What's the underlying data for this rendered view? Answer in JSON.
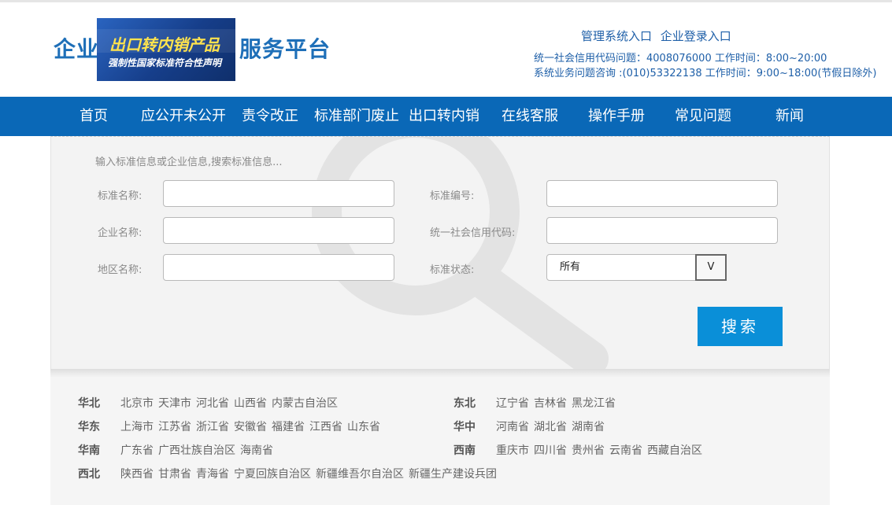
{
  "header": {
    "title_left": "企业",
    "title_right": "服务平台",
    "promo": {
      "line1": "出口转内销产品",
      "line2": "强制性国家标准符合性声明"
    },
    "links": [
      "管理系统入口",
      "企业登录入口"
    ],
    "contact_line1": "统一社会信用代码问题：4008076000 工作时间：8:00~20:00",
    "contact_line2": "系统业务问题咨询 :(010)53322138 工作时间：9:00~18:00(节假日除外)"
  },
  "nav": {
    "items": [
      "首页",
      "应公开未公开",
      "责令改正",
      "标准部门废止",
      "出口转内销",
      "在线客服",
      "操作手册",
      "常见问题",
      "新闻"
    ]
  },
  "search": {
    "hint": "输入标准信息或企业信息,搜索标准信息...",
    "standard_name_label": "标准名称:",
    "standard_no_label": "标准编号:",
    "company_name_label": "企业名称:",
    "credit_code_label": "统一社会信用代码:",
    "region_label": "地区名称:",
    "status_label": "标准状态:",
    "status_value": "所有",
    "status_toggle": "V",
    "button": "搜索"
  },
  "regions": [
    {
      "name": "华北",
      "places": [
        "北京市",
        "天津市",
        "河北省",
        "山西省",
        "内蒙古自治区"
      ]
    },
    {
      "name": "东北",
      "places": [
        "辽宁省",
        "吉林省",
        "黑龙江省"
      ]
    },
    {
      "name": "华东",
      "places": [
        "上海市",
        "江苏省",
        "浙江省",
        "安徽省",
        "福建省",
        "江西省",
        "山东省"
      ]
    },
    {
      "name": "华中",
      "places": [
        "河南省",
        "湖北省",
        "湖南省"
      ]
    },
    {
      "name": "华南",
      "places": [
        "广东省",
        "广西壮族自治区",
        "海南省"
      ]
    },
    {
      "name": "西南",
      "places": [
        "重庆市",
        "四川省",
        "贵州省",
        "云南省",
        "西藏自治区"
      ]
    },
    {
      "name": "西北",
      "places": [
        "陕西省",
        "甘肃省",
        "青海省",
        "宁夏回族自治区",
        "新疆维吾尔自治区",
        "新疆生产建设兵团"
      ]
    }
  ],
  "colors": {
    "nav_bg": "#0a68b7",
    "brand_blue": "#1e6fb8",
    "search_button": "#0a8fd8"
  }
}
